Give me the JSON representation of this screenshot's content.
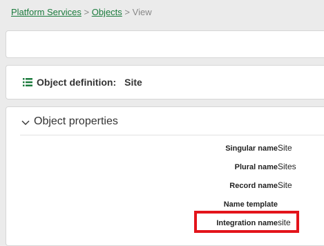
{
  "breadcrumb": {
    "root": "Platform Services",
    "separator": ">",
    "objects": "Objects",
    "current": "View"
  },
  "definition": {
    "icon": "list-icon",
    "label": "Object definition:",
    "value": "Site"
  },
  "properties": {
    "title": "Object properties",
    "icon": "chevron-down-icon",
    "rows": [
      {
        "label": "Singular name",
        "value": "Site"
      },
      {
        "label": "Plural name",
        "value": "Sites"
      },
      {
        "label": "Record name",
        "value": "Site"
      },
      {
        "label": "Name template",
        "value": ""
      },
      {
        "label": "Integration name",
        "value": "site"
      }
    ]
  },
  "colors": {
    "link": "#1a7a3c",
    "highlight": "#e3141b"
  }
}
